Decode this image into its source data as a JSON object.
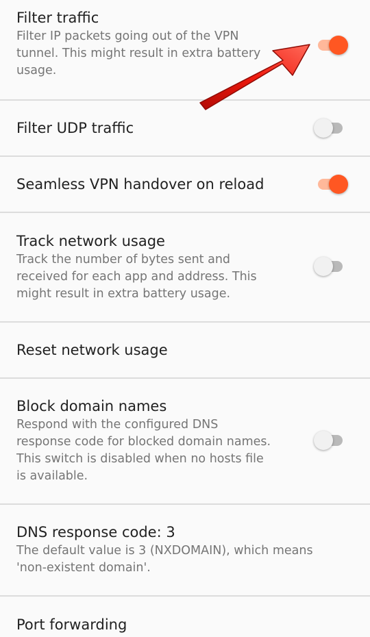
{
  "settings": [
    {
      "title": "Filter traffic",
      "summary": "Filter IP packets going out of the VPN\ntunnel. This might result in extra battery\nusage.",
      "toggle": true,
      "checked": true
    },
    {
      "title": "Filter UDP traffic",
      "summary": "",
      "toggle": true,
      "checked": false
    },
    {
      "title": "Seamless VPN handover on reload",
      "summary": "",
      "toggle": true,
      "checked": true
    },
    {
      "title": "Track network usage",
      "summary": "Track the number of bytes sent and\nreceived for each app and address. This\nmight result in extra battery usage.",
      "toggle": true,
      "checked": false
    },
    {
      "title": "Reset network usage",
      "summary": "",
      "toggle": false,
      "checked": false
    },
    {
      "title": "Block domain names",
      "summary": "Respond with the configured DNS\nresponse code for blocked domain names.\nThis switch is disabled when no hosts file\nis available.",
      "toggle": true,
      "checked": false
    },
    {
      "title": "DNS response code: 3",
      "summary": "The default value is 3 (NXDOMAIN), which means\n'non-existent domain'.",
      "toggle": false,
      "checked": false
    },
    {
      "title": "Port forwarding",
      "summary": "",
      "toggle": false,
      "checked": false
    }
  ],
  "colors": {
    "accent": "#ff5722",
    "accent_track": "#ffb89a",
    "off_thumb": "#f1f1f1",
    "off_track": "#b9b9b9",
    "annotation_arrow": "#e8190e"
  }
}
